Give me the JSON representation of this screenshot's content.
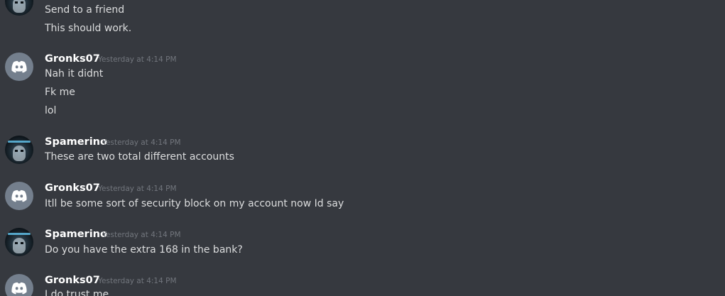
{
  "messages": {
    "prev": {
      "lines": [
        "Send to a friend",
        "This should work."
      ]
    },
    "m1": {
      "author": "Gronks07",
      "time": "Yesterday at 4:14 PM",
      "lines": [
        "Nah it didnt",
        "Fk me",
        "lol"
      ]
    },
    "m2": {
      "author": "Spamerino",
      "time": "Yesterday at 4:14 PM",
      "lines": [
        "These are two total different accounts"
      ]
    },
    "m3": {
      "author": "Gronks07",
      "time": "Yesterday at 4:14 PM",
      "lines": [
        "Itll be some sort of security block on my account now Id say"
      ]
    },
    "m4": {
      "author": "Spamerino",
      "time": "Yesterday at 4:14 PM",
      "lines": [
        "Do you have the extra 168 in the bank?"
      ]
    },
    "m5": {
      "author": "Gronks07",
      "time": "Yesterday at 4:14 PM",
      "lines": [
        "I do trust me"
      ]
    }
  },
  "icons": {
    "default_avatar": "discord-default-avatar-icon",
    "user_avatar": "masked-figure-avatar"
  }
}
